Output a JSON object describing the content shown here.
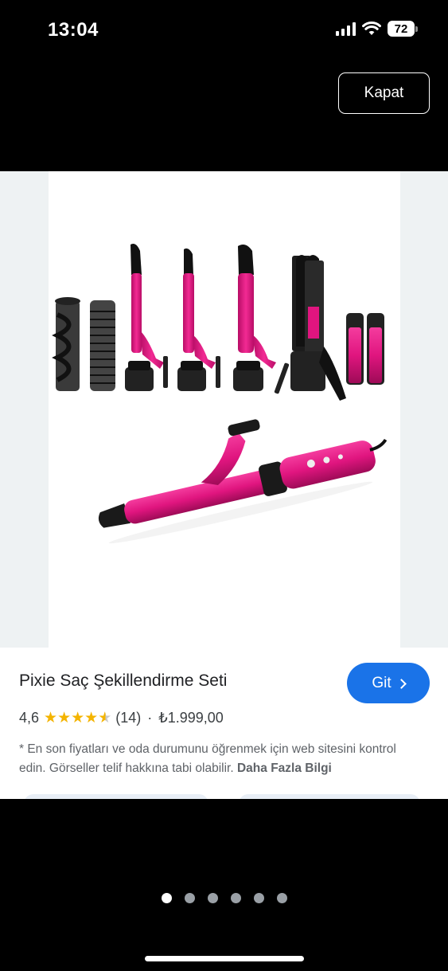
{
  "status_bar": {
    "time": "13:04",
    "battery": "72"
  },
  "header": {
    "close_label": "Kapat"
  },
  "product": {
    "title": "Pixie Saç Şekillendirme Seti",
    "go_label": "Git",
    "rating": "4,6",
    "stars": 4.6,
    "review_count": "(14)",
    "separator": "·",
    "price": "₺1.999,00",
    "disclaimer": "* En son fiyatları ve oda durumunu öğrenmek için web sitesini kontrol edin. Görseller telif hakkına tabi olabilir.",
    "more_info": "Daha Fazla Bilgi"
  },
  "pager": {
    "total": 6,
    "active": 1
  },
  "colors": {
    "accent": "#1a73e8",
    "star": "#f4b400",
    "product_pink": "#e0157f"
  },
  "icons": [
    "cellular-signal-icon",
    "wifi-icon",
    "battery-icon",
    "star-icon",
    "chevron-right-icon"
  ]
}
